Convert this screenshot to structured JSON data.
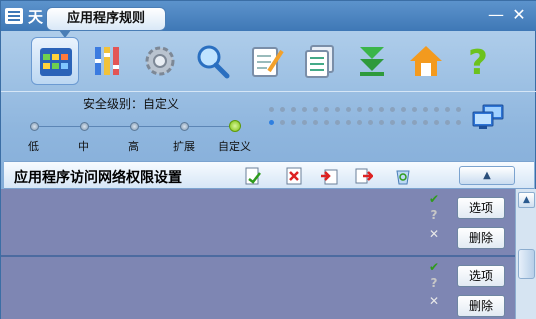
{
  "window": {
    "title": "天",
    "minimize": "—",
    "close": "✕"
  },
  "tooltip": "应用程序规则",
  "toolbar": {
    "tools": [
      "app-rules-icon",
      "columns-icon",
      "gear-icon",
      "magnifier-icon",
      "notepad-icon",
      "log-icon",
      "download-icon",
      "home-icon",
      "help-icon"
    ]
  },
  "security": {
    "label": "安全级别：自定义",
    "levels": [
      "低",
      "中",
      "高",
      "扩展",
      "自定义"
    ],
    "active_index": 4
  },
  "section": {
    "title": "应用程序访问网络权限设置",
    "collapse": "▲"
  },
  "rows": [
    {
      "ok": "✔",
      "ask": "?",
      "deny": "✕",
      "options": "选项",
      "delete": "删除"
    },
    {
      "ok": "✔",
      "ask": "?",
      "deny": "✕",
      "options": "选项",
      "delete": "删除"
    }
  ],
  "scrollbar": {
    "up": "▲"
  },
  "colors": {
    "accent": "#3f78b6",
    "row_bg": "#7e86b3",
    "active_level": "#7cc10c"
  }
}
